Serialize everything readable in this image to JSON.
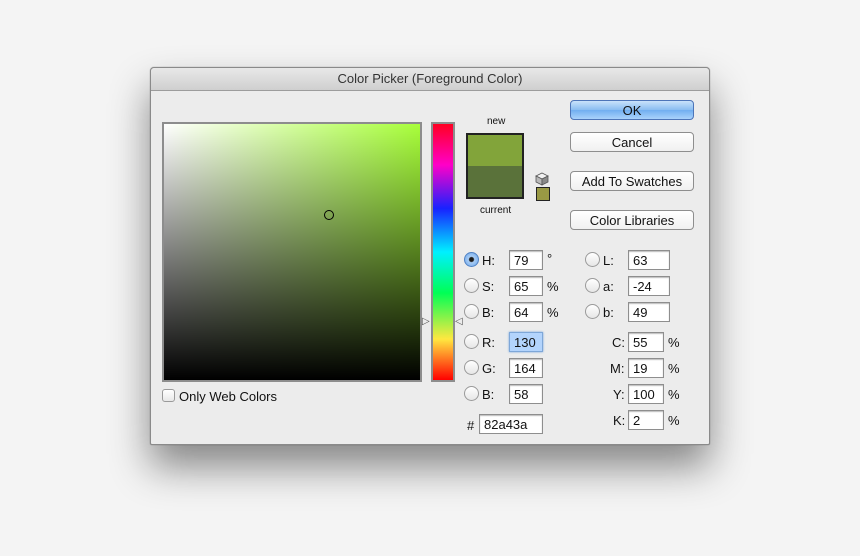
{
  "window": {
    "title": "Color Picker (Foreground Color)"
  },
  "buttons": {
    "ok": "OK",
    "cancel": "Cancel",
    "add_to_swatches": "Add To Swatches",
    "color_libraries": "Color Libraries"
  },
  "swatches": {
    "new_label": "new",
    "current_label": "current",
    "new_color": "#82a43a",
    "current_color": "#5a723a",
    "gamut_color": "#999944",
    "icons": {
      "out_of_gamut": "cube-icon"
    }
  },
  "field": {
    "hue_color": "#a8ff3a"
  },
  "hsb": {
    "h": {
      "label": "H:",
      "value": "79",
      "unit": "°",
      "selected": true
    },
    "s": {
      "label": "S:",
      "value": "65",
      "unit": "%"
    },
    "b": {
      "label": "B:",
      "value": "64",
      "unit": "%"
    }
  },
  "rgb": {
    "r": {
      "label": "R:",
      "value": "130"
    },
    "g": {
      "label": "G:",
      "value": "164"
    },
    "b": {
      "label": "B:",
      "value": "58"
    }
  },
  "lab": {
    "l": {
      "label": "L:",
      "value": "63"
    },
    "a": {
      "label": "a:",
      "value": "-24"
    },
    "b": {
      "label": "b:",
      "value": "49"
    }
  },
  "cmyk": {
    "c": {
      "label": "C:",
      "value": "55",
      "unit": "%"
    },
    "m": {
      "label": "M:",
      "value": "19",
      "unit": "%"
    },
    "y": {
      "label": "Y:",
      "value": "100",
      "unit": "%"
    },
    "k": {
      "label": "K:",
      "value": "2",
      "unit": "%"
    }
  },
  "hex": {
    "label": "#",
    "value": "82a43a"
  },
  "options": {
    "only_web_colors": {
      "label": "Only Web Colors",
      "checked": false
    }
  }
}
